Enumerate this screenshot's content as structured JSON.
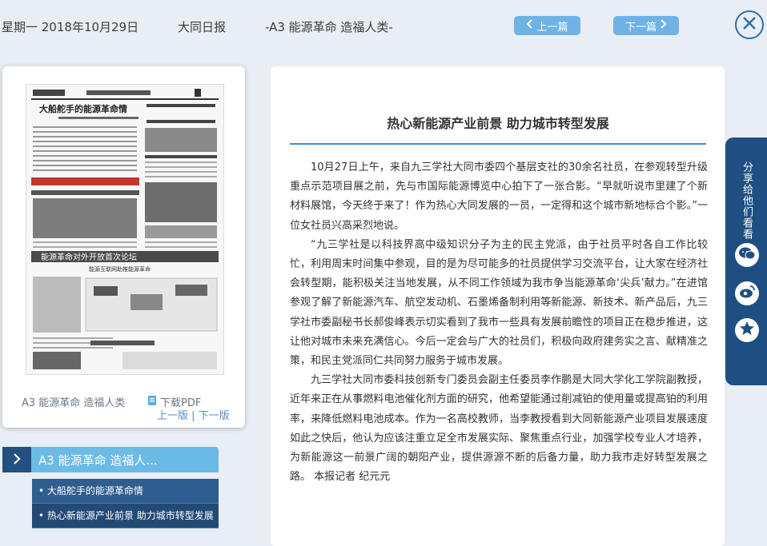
{
  "header": {
    "date": "星期一 2018年10月29日",
    "paper": "大同日报",
    "section": "-A3 能源革命 造福人类-",
    "prev_label": "上一篇",
    "next_label": "下一篇"
  },
  "thumbnail": {
    "page_label": "A3 能源革命 造福人类",
    "pdf_label": "下载PDF",
    "prev_page": "上一版",
    "separator": "|",
    "next_page": "下一版",
    "headlines": {
      "top_headline": "大船舵手的能源革命情",
      "middle_banner": "能源革命对外开放首次论坛",
      "bottom_banner": "能源互联网助推能源革命"
    }
  },
  "section_panel": {
    "title": "A3 能源革命 造福人...",
    "items": [
      "大船舵手的能源革命情",
      "热心新能源产业前景 助力城市转型发展"
    ]
  },
  "article": {
    "title": "热心新能源产业前景 助力城市转型发展",
    "paragraphs": [
      "10月27日上午，来自九三学社大同市委四个基层支社的30余名社员，在参观转型升级重点示范项目展之前，先与市国际能源博览中心拍下了一张合影。“早就听说市里建了个新材料展馆，今天终于来了！作为热心大同发展的一员，一定得和这个城市新地标合个影。”一位女社员兴高采烈地说。",
      "“九三学社是以科技界高中级知识分子为主的民主党派，由于社员平时各自工作比较忙，利用周末时间集中参观，目的是为尽可能多的社员提供学习交流平台，让大家在经济社会转型期，能积极关注当地发展，从不同工作领域为我市争当能源革命‘尖兵’献力。”在进馆参观了解了新能源汽车、航空发动机、石墨烯备制利用等新能源、新技术、新产品后，九三学社市委副秘书长郝俊峰表示切实看到了我市一些具有发展前瞻性的项目正在稳步推进，这让他对城市未来充满信心。今后一定会与广大的社员们，积极向政府建务实之言、献精准之策，和民主党派同仁共同努力服务于城市发展。",
      "九三学社大同市委科技创新专门委员会副主任委员李作鹏是大同大学化工学院副教授，近年来正在从事燃料电池催化剂方面的研究，他希望能通过削减铂的使用量或提高铂的利用率，来降低燃料电池成本。作为一名高校教师，当李教授看到大同新能源产业项目发展速度如此之快后，他认为应该注重立足全市发展实际、聚焦重点行业，加强学校专业人才培养，为新能源这一前景广阔的朝阳产业，提供源源不断的后备力量，助力我市走好转型发展之路。 本报记者 纪元元"
    ]
  },
  "share": {
    "label": "分享给他们看看"
  }
}
